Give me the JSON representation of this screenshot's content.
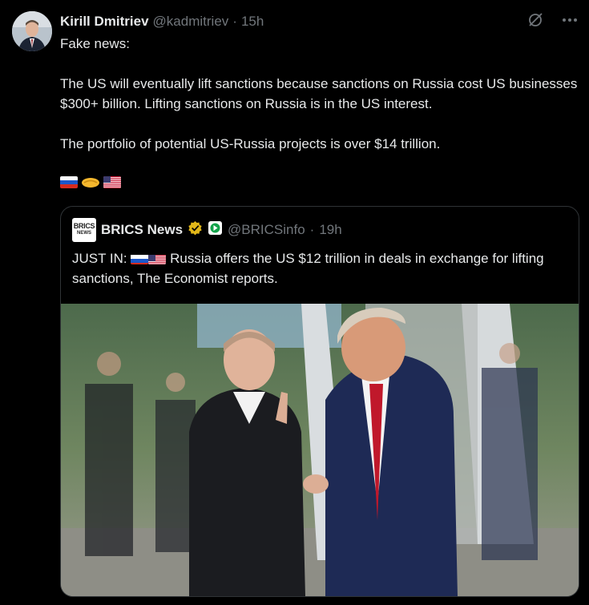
{
  "tweet": {
    "author_name": "Kirill Dmitriev",
    "author_handle": "@kadmitriev",
    "separator": "·",
    "time": "15h",
    "paragraphs": [
      "Fake news:",
      "The US will eventually lift sanctions because sanctions on Russia cost US businesses $300+ billion. Lifting sanctions on Russia is in the US interest.",
      "The portfolio of potential US-Russia projects is over $14 trillion."
    ],
    "emoji": [
      "russia-flag",
      "handshake",
      "us-flag"
    ]
  },
  "quoted_tweet": {
    "logo_text_top": "BRICS",
    "logo_text_bottom": "NEWS",
    "author_name": "BRICS News",
    "author_handle": "@BRICSinfo",
    "separator": "·",
    "time": "19h",
    "text_prefix": "JUST IN:",
    "text_body": "Russia offers the US $12 trillion in deals in exchange for lifting sanctions, The Economist reports."
  },
  "colors": {
    "background": "#000000",
    "text": "#e7e9ea",
    "muted": "#71767b",
    "border": "#2f3336",
    "verified_gold": "#e2b719"
  },
  "icons": [
    "grok-icon",
    "more-icon",
    "verified-badge-icon",
    "affiliate-badge-icon"
  ]
}
